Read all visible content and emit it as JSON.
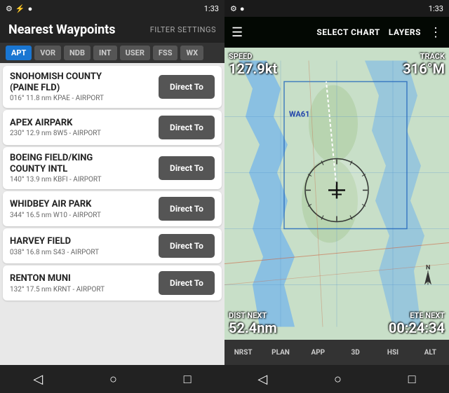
{
  "left": {
    "status_bar": {
      "icons": "signal wifi battery",
      "time": "1:33"
    },
    "header": {
      "title": "Nearest Waypoints",
      "filter_btn": "FILTER SETTINGS"
    },
    "tabs": [
      {
        "label": "APT",
        "active": true
      },
      {
        "label": "VOR",
        "active": false
      },
      {
        "label": "NDB",
        "active": false
      },
      {
        "label": "INT",
        "active": false
      },
      {
        "label": "USER",
        "active": false
      },
      {
        "label": "FSS",
        "active": false
      },
      {
        "label": "WX",
        "active": false
      }
    ],
    "waypoints": [
      {
        "name": "SNOHOMISH COUNTY\n(PAINE FLD)",
        "name_line1": "SNOHOMISH COUNTY",
        "name_line2": "(PAINE FLD)",
        "details": "016°  11.8 nm  KPAE - AIRPORT",
        "btn": "Direct To"
      },
      {
        "name_line1": "APEX AIRPARK",
        "name_line2": "",
        "details": "230°  12.9 nm  8W5 - AIRPORT",
        "btn": "Direct To"
      },
      {
        "name_line1": "BOEING FIELD/KING",
        "name_line2": "COUNTY INTL",
        "details": "140°  13.9 nm  KBFI - AIRPORT",
        "btn": "Direct To"
      },
      {
        "name_line1": "WHIDBEY AIR PARK",
        "name_line2": "",
        "details": "344°  16.5 nm  W10 - AIRPORT",
        "btn": "Direct To"
      },
      {
        "name_line1": "HARVEY FIELD",
        "name_line2": "",
        "details": "038°  16.8 nm  S43 - AIRPORT",
        "btn": "Direct To"
      },
      {
        "name_line1": "RENTON MUNI",
        "name_line2": "",
        "details": "132°  17.5 nm  KRNT - AIRPORT",
        "btn": "Direct To"
      }
    ],
    "nav": {
      "back": "◁",
      "home": "○",
      "recent": "□"
    }
  },
  "right": {
    "status_bar": {
      "icons": "signal wifi battery",
      "time": "1:33"
    },
    "header": {
      "select_chart": "SELECT CHART",
      "layers": "LAYERS"
    },
    "map": {
      "speed_label": "SPEED",
      "speed_value": "127.9kt",
      "track_label": "TRACK",
      "track_value": "316°M",
      "dist_label": "DIST NEXT",
      "dist_value": "52.4nm",
      "ete_label": "ETE NEXT",
      "ete_value": "00:24:34",
      "waypoint_label": "WA61"
    },
    "tabs": [
      {
        "label": "NRST",
        "active": false
      },
      {
        "label": "PLAN",
        "active": false
      },
      {
        "label": "APP",
        "active": false
      },
      {
        "label": "3D",
        "active": false
      },
      {
        "label": "HSI",
        "active": false
      },
      {
        "label": "ALT",
        "active": false
      }
    ],
    "nav": {
      "back": "◁",
      "home": "○",
      "recent": "□"
    }
  }
}
